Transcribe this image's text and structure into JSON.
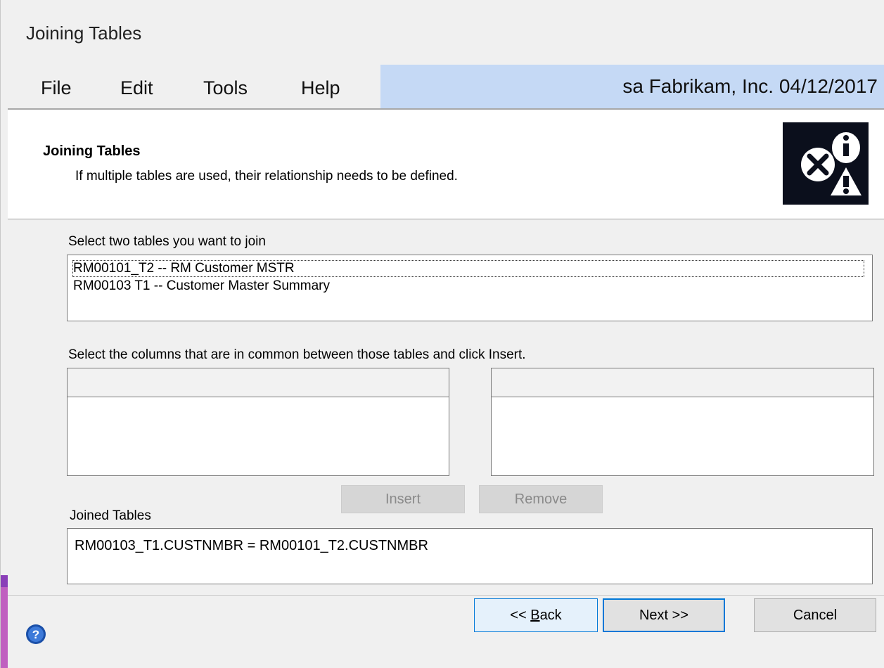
{
  "window": {
    "title": "Joining Tables"
  },
  "menu": {
    "items": [
      "File",
      "Edit",
      "Tools",
      "Help"
    ]
  },
  "status": {
    "text": "sa  Fabrikam, Inc.  04/12/2017"
  },
  "header": {
    "title": "Joining Tables",
    "description": "If multiple tables are used, their relationship needs to be defined.",
    "icon": "warning-info-error-icon"
  },
  "tables": {
    "label": "Select two tables you want to join",
    "items": [
      "RM00101_T2 -- RM Customer MSTR",
      "RM00103  T1 -- Customer Master Summary"
    ]
  },
  "columns": {
    "label": "Select the columns that are in common between those tables and click Insert."
  },
  "buttons": {
    "insert": "Insert",
    "remove": "Remove",
    "back_prefix": "<< ",
    "back_accel": "B",
    "back_rest": "ack",
    "next": "Next >>",
    "cancel": "Cancel"
  },
  "joined": {
    "label": "Joined Tables",
    "value": "RM00103_T1.CUSTNMBR = RM00101_T2.CUSTNMBR"
  },
  "colors": {
    "status_bg": "#c5d9f5",
    "focus_border": "#0078d7",
    "icon_bg": "#0b0f1c"
  }
}
